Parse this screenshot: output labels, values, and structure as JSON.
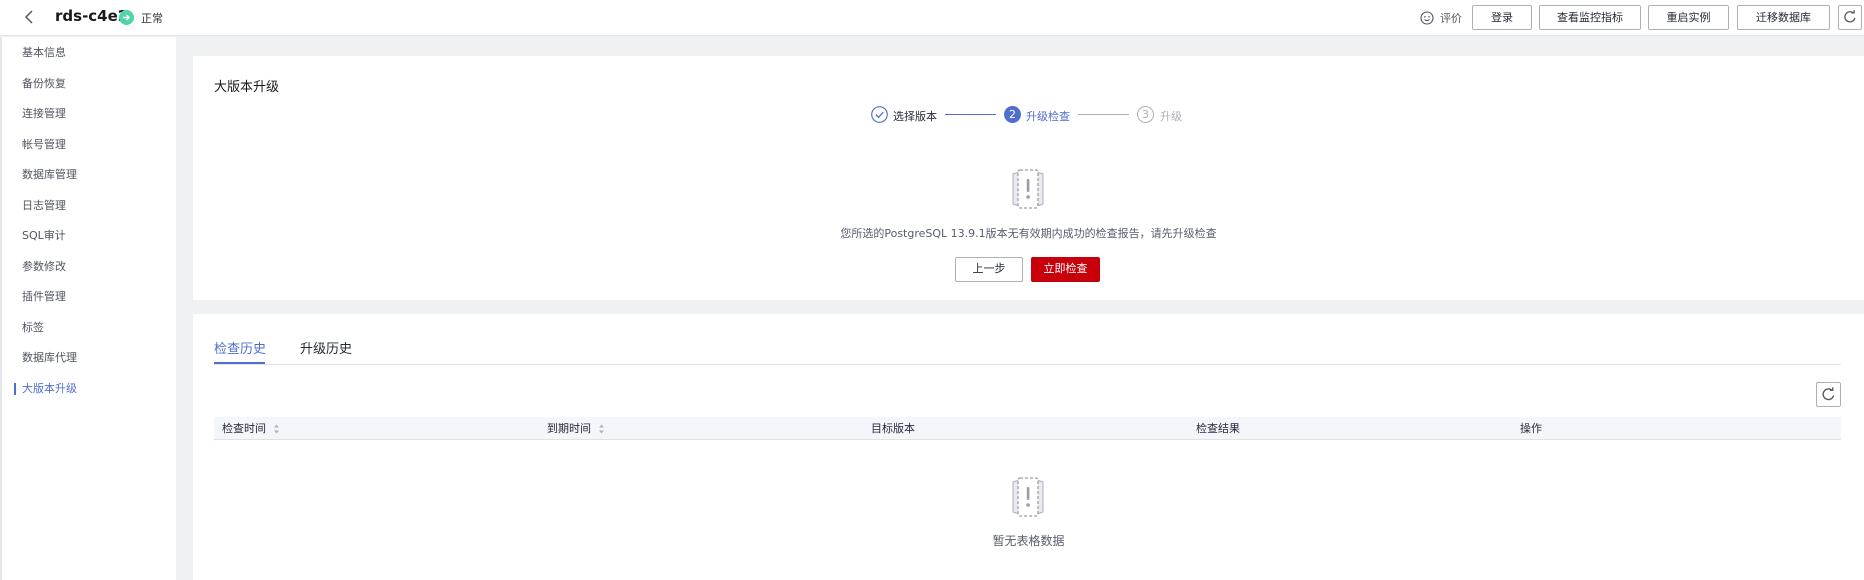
{
  "header": {
    "instance_name": "rds-c4e2",
    "status": "正常",
    "rate_label": "评价",
    "buttons": [
      "登录",
      "查看监控指标",
      "重启实例",
      "迁移数据库"
    ]
  },
  "sidebar": {
    "items": [
      {
        "label": "基本信息"
      },
      {
        "label": "备份恢复"
      },
      {
        "label": "连接管理"
      },
      {
        "label": "帐号管理"
      },
      {
        "label": "数据库管理"
      },
      {
        "label": "日志管理"
      },
      {
        "label": "SQL审计"
      },
      {
        "label": "参数修改"
      },
      {
        "label": "插件管理"
      },
      {
        "label": "标签"
      },
      {
        "label": "数据库代理"
      },
      {
        "label": "大版本升级",
        "active": true
      }
    ]
  },
  "upgrade": {
    "title": "大版本升级",
    "steps": [
      {
        "number": "1",
        "label": "选择版本",
        "state": "done"
      },
      {
        "number": "2",
        "label": "升级检查",
        "state": "current"
      },
      {
        "number": "3",
        "label": "升级",
        "state": "pending"
      }
    ],
    "message": "您所选的PostgreSQL 13.9.1版本无有效期内成功的检查报告，请先升级检查",
    "prev_button": "上一步",
    "check_button": "立即检查"
  },
  "history": {
    "tabs": [
      {
        "label": "检查历史",
        "active": true
      },
      {
        "label": "升级历史",
        "active": false
      }
    ],
    "columns": [
      {
        "label": "检查时间",
        "sortable": true
      },
      {
        "label": "到期时间",
        "sortable": true
      },
      {
        "label": "目标版本",
        "sortable": false
      },
      {
        "label": "检查结果",
        "sortable": false
      },
      {
        "label": "操作",
        "sortable": false
      }
    ],
    "empty_text": "暂无表格数据"
  },
  "colors": {
    "accent": "#526ecc",
    "primary_button": "#c7000b",
    "status_ok": "#50d4ab"
  },
  "icons": [
    "back-arrow-icon",
    "status-ok-icon",
    "smile-icon",
    "refresh-icon",
    "check-circle-icon",
    "empty-doc-icon",
    "sort-icon"
  ]
}
